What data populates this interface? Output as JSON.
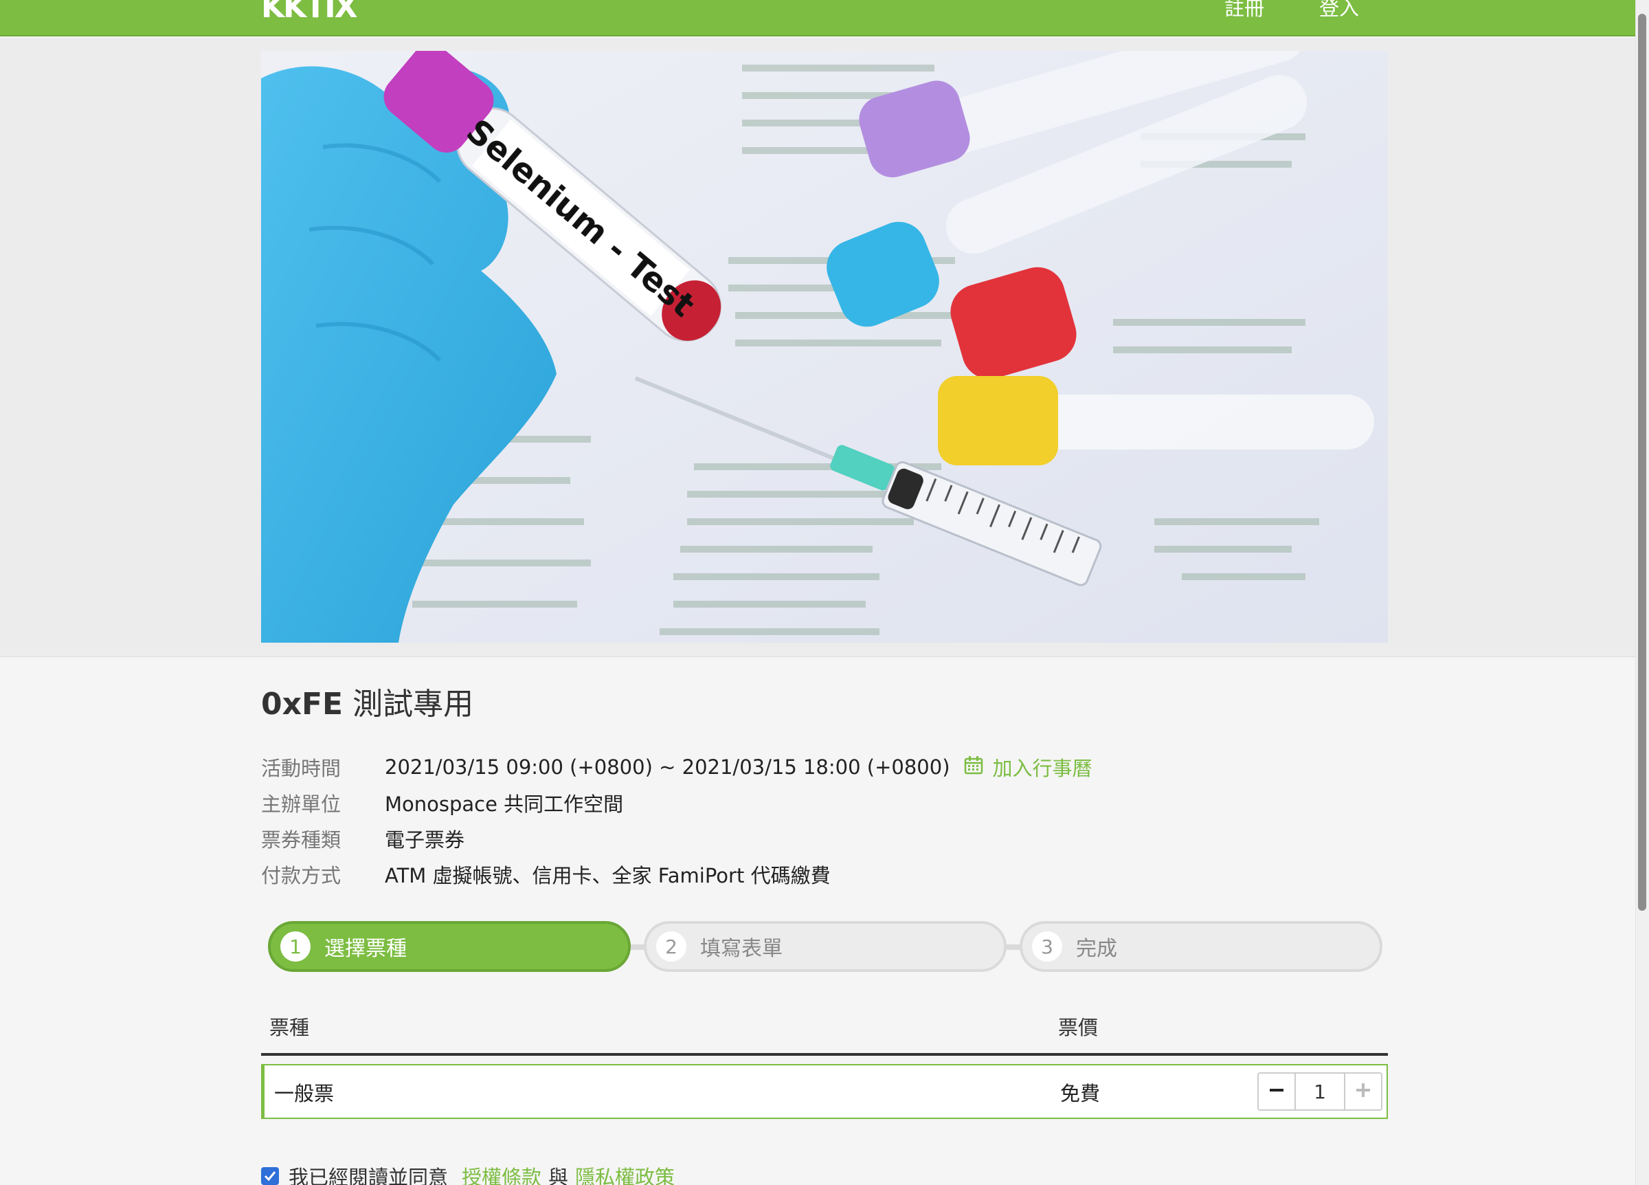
{
  "header": {
    "logo_text": "KKTIX",
    "register_label": "註冊",
    "login_label": "登入"
  },
  "hero": {
    "tube_label": "Selenium - Test"
  },
  "event": {
    "title_prefix": "0xFE",
    "title_rest": " 測試專用",
    "rows": [
      {
        "label": "活動時間",
        "value": "2021/03/15 09:00 (+0800) ~ 2021/03/15 18:00 (+0800)"
      },
      {
        "label": "主辦單位",
        "value": "Monospace 共同工作空間"
      },
      {
        "label": "票券種類",
        "value": "電子票券"
      },
      {
        "label": "付款方式",
        "value": "ATM 虛擬帳號、信用卡、全家 FamiPort 代碼繳費"
      }
    ],
    "calendar_link": "加入行事曆"
  },
  "steps": [
    {
      "num": "1",
      "label": "選擇票種",
      "active": true
    },
    {
      "num": "2",
      "label": "填寫表單",
      "active": false
    },
    {
      "num": "3",
      "label": "完成",
      "active": false
    }
  ],
  "table": {
    "col_ticket": "票種",
    "col_price": "票價",
    "rows": [
      {
        "name": "一般票",
        "price": "免費",
        "quantity": "1"
      }
    ]
  },
  "agreement": {
    "checked": true,
    "text_before": "我已經閱讀並同意",
    "terms_link": "授權條款",
    "and_text": "與",
    "privacy_link": "隱私權政策"
  },
  "colors": {
    "brand_green": "#7cbd42",
    "checkbox_blue": "#2e6fd8"
  }
}
